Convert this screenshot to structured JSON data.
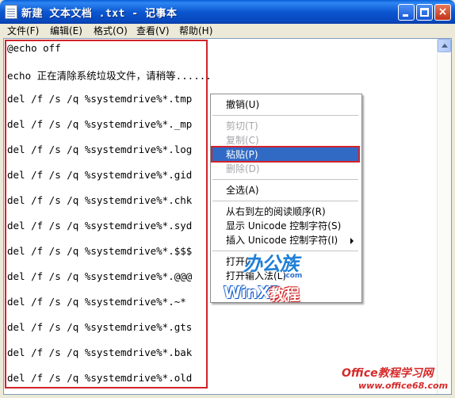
{
  "window": {
    "title": "新建 文本文档 .txt - 记事本",
    "icon": "notepad-icon",
    "buttons": {
      "minimize": "minimize-icon",
      "maximize": "maximize-icon",
      "close": "×"
    }
  },
  "menubar": {
    "items": [
      "文件(F)",
      "编辑(E)",
      "格式(O)",
      "查看(V)",
      "帮助(H)"
    ]
  },
  "document": {
    "lines": [
      "@echo off",
      "echo 正在清除系统垃圾文件，请稍等......",
      "del /f /s /q %systemdrive%*.tmp",
      "del /f /s /q %systemdrive%*._mp",
      "del /f /s /q %systemdrive%*.log",
      "del /f /s /q %systemdrive%*.gid",
      "del /f /s /q %systemdrive%*.chk",
      "del /f /s /q %systemdrive%*.syd",
      "del /f /s /q %systemdrive%*.$$$",
      "del /f /s /q %systemdrive%*.@@@",
      "del /f /s /q %systemdrive%*.~*",
      "del /f /s /q %systemdrive%*.gts",
      "del /f /s /q %systemdrive%*.bak",
      "del /f /s /q %systemdrive%*.old"
    ]
  },
  "context_menu": {
    "items": [
      {
        "label": "撤销(U)",
        "enabled": true
      },
      {
        "label": "剪切(T)",
        "enabled": false
      },
      {
        "label": "复制(C)",
        "enabled": false
      },
      {
        "label": "粘贴(P)",
        "enabled": true,
        "selected": true
      },
      {
        "label": "删除(D)",
        "enabled": false
      },
      {
        "label": "全选(A)",
        "enabled": true
      },
      {
        "label": "从右到左的阅读顺序(R)",
        "enabled": true
      },
      {
        "label": "显示 Unicode 控制字符(S)",
        "enabled": true
      },
      {
        "label": "插入 Unicode 控制字符(I)",
        "enabled": true,
        "submenu": true
      },
      {
        "label": "打开(O)",
        "enabled": true
      },
      {
        "label": "打开输入法(L)",
        "enabled": true
      }
    ]
  },
  "watermarks": {
    "brand": "办公族",
    "brand_url": ".com",
    "winxp": "WinXP",
    "tutorial": "教程",
    "office_site": "Office教程学习网",
    "office_url": "www.office68.com"
  },
  "colors": {
    "title_bar": "#0b57d0",
    "selection": "#316ac5",
    "annotation_border": "#d2232a"
  }
}
